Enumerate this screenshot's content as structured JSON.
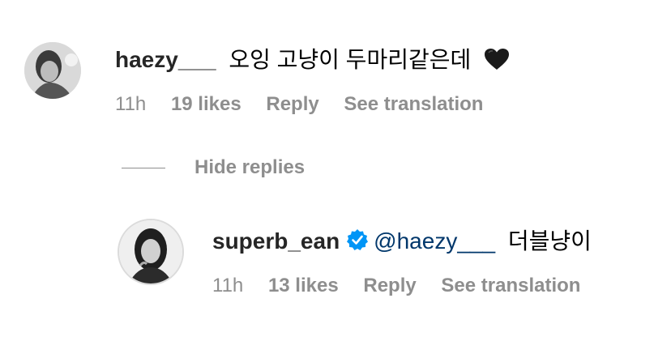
{
  "comment": {
    "username": "haezy___",
    "text": "오잉 고냥이 두마리같은데",
    "heart_emoji": "black-heart-icon",
    "time": "11h",
    "likes": "19 likes",
    "reply_label": "Reply",
    "translation_label": "See translation"
  },
  "hide_replies_label": "Hide replies",
  "reply": {
    "username": "superb_ean",
    "mention": "@haezy___",
    "text": "더블냥이",
    "time": "11h",
    "likes": "13 likes",
    "reply_label": "Reply",
    "translation_label": "See translation"
  },
  "colors": {
    "text": "#262626",
    "secondary": "#8e8e8e",
    "mention": "#00376b",
    "verified": "#0095f6"
  }
}
